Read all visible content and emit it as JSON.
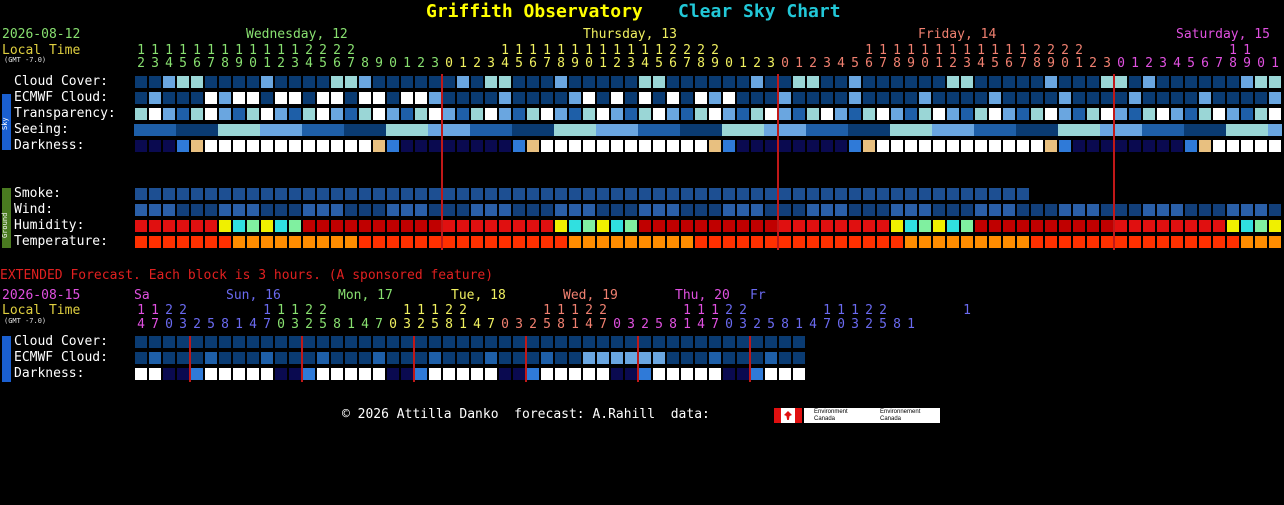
{
  "header": {
    "title_main": "Griffith Observatory",
    "title_sub": "Clear Sky Chart",
    "date": "2026-08-12",
    "local_time": "Local Time",
    "gmt": "(GMT -7.0)",
    "days": [
      "Wednesday, 12",
      "Thursday, 13",
      "Friday, 14",
      "Saturday, 15"
    ],
    "hour_tens_row": "1111111111112222          1111111111112222          1111111111112222          11",
    "hour_ones_row": "2345678901234567890123012345678901234567890123012345678901234567890123012345678901"
  },
  "sidebar": {
    "sky_label": "Sky",
    "ground_label": "Ground"
  },
  "rows": {
    "cloud": "Cloud Cover:",
    "ecmwf": "ECMWF Cloud:",
    "transparency": "Transparency:",
    "seeing": "Seeing:",
    "darkness": "Darkness:",
    "smoke": "Smoke:",
    "wind": "Wind:",
    "humidity": "Humidity:",
    "temperature": "Temperature:"
  },
  "extended": {
    "note": "EXTENDED Forecast. Each block is 3 hours. (A sponsored feature)",
    "date": "2026-08-15",
    "local_time": "Local Time",
    "gmt": "(GMT -7.0)",
    "days": [
      "Sa",
      "Sun, 16",
      "Mon, 17",
      "Tue, 18",
      "Wed, 19",
      "Thu, 20",
      "Fr"
    ],
    "hour_tens_row": "1122     11122     11122     11122     11122     11122     1",
    "hour_ones_row": "47032581470325814703258147032581470325814703258147032581",
    "rows": {
      "cloud": "Cloud Cover:",
      "ecmwf": "ECMWF Cloud:",
      "darkness": "Darkness:"
    }
  },
  "footer": {
    "credit": "© 2026 Attilla Danko  forecast: A.Rahill  data:",
    "logo_text_1": "Environment",
    "logo_text_2": "Canada",
    "logo_text_3": "Environnement",
    "logo_text_4": "Canada"
  },
  "colors": {
    "title_main": "#ffff00",
    "title_sub": "#22c8d8",
    "wed": "#88e070",
    "thu": "#f0f060",
    "fri": "#f08070",
    "sat": "#e050e0",
    "date": "#88e070",
    "local": "#e0d040",
    "hours": "#e0e040",
    "midnight": "#c01818",
    "extended": "#e02020"
  }
}
